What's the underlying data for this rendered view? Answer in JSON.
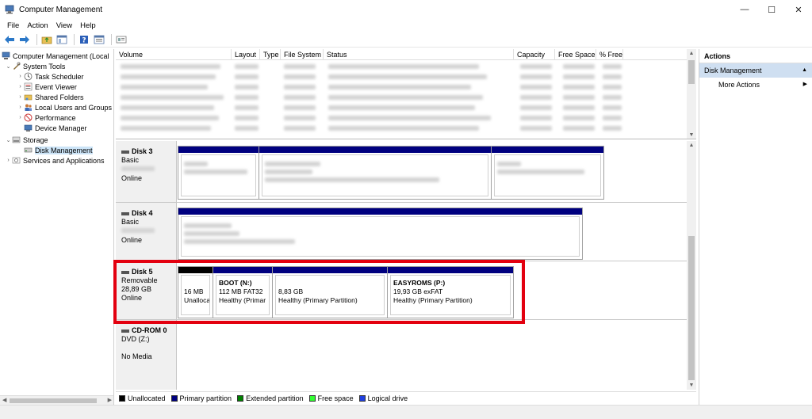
{
  "window": {
    "title": "Computer Management",
    "minimize": "—",
    "maximize": "☐",
    "close": "✕"
  },
  "menu": [
    "File",
    "Action",
    "View",
    "Help"
  ],
  "tree": {
    "root": "Computer Management (Local",
    "system_tools": "System Tools",
    "task_scheduler": "Task Scheduler",
    "event_viewer": "Event Viewer",
    "shared_folders": "Shared Folders",
    "local_users": "Local Users and Groups",
    "performance": "Performance",
    "device_manager": "Device Manager",
    "storage": "Storage",
    "disk_management": "Disk Management",
    "services": "Services and Applications"
  },
  "volume_list": {
    "headers": [
      "Volume",
      "Layout",
      "Type",
      "File System",
      "Status",
      "Capacity",
      "Free Space",
      "% Free"
    ]
  },
  "disks": {
    "disk3": {
      "name": "Disk 3",
      "type": "Basic",
      "status": "Online"
    },
    "disk4": {
      "name": "Disk 4",
      "type": "Basic",
      "status": "Online"
    },
    "disk5": {
      "name": "Disk 5",
      "type": "Removable",
      "size": "28,89 GB",
      "status": "Online",
      "parts": [
        {
          "name": "",
          "size": "16 MB",
          "status": "Unalloca"
        },
        {
          "name": "BOOT  (N:)",
          "size": "112 MB FAT32",
          "status": "Healthy (Primar"
        },
        {
          "name": "",
          "size": "8,83 GB",
          "status": "Healthy (Primary Partition)"
        },
        {
          "name": "EASYROMS  (P:)",
          "size": "19,93 GB exFAT",
          "status": "Healthy (Primary Partition)"
        }
      ]
    },
    "cdrom": {
      "name": "CD-ROM 0",
      "type": "DVD (Z:)",
      "status": "No Media"
    }
  },
  "legend": [
    {
      "label": "Unallocated",
      "color": "#000000"
    },
    {
      "label": "Primary partition",
      "color": "#00007f"
    },
    {
      "label": "Extended partition",
      "color": "#008000"
    },
    {
      "label": "Free space",
      "color": "#33ff33"
    },
    {
      "label": "Logical drive",
      "color": "#2040e0"
    }
  ],
  "actions": {
    "header": "Actions",
    "section": "Disk Management",
    "more": "More Actions"
  }
}
